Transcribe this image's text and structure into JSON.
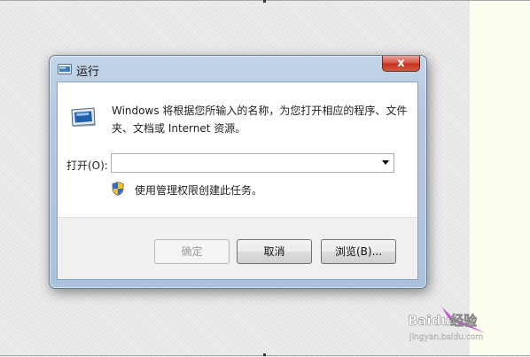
{
  "window": {
    "title": "运行",
    "close_glyph": "x"
  },
  "dialog": {
    "description": "Windows 将根据您所输入的名称，为您打开相应的程序、文件夹、文档或 Internet 资源。",
    "open_label": "打开(O):",
    "open_value": "",
    "admin_note": "使用管理权限创建此任务。"
  },
  "buttons": {
    "ok": "确定",
    "cancel": "取消",
    "browse": "浏览(B)..."
  },
  "icons": {
    "run": "run-program-icon",
    "shield": "uac-shield-icon",
    "dropdown": "chevron-down-icon"
  },
  "watermark": {
    "text": "Baidu经验",
    "sub": "jingyan.baidu.com"
  }
}
